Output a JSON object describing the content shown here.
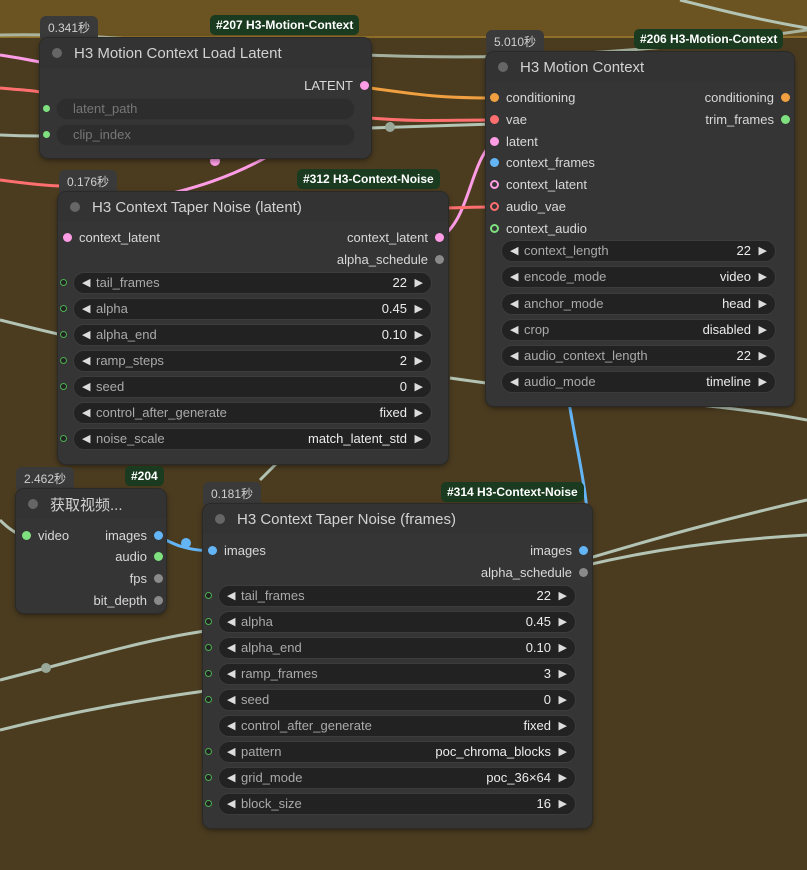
{
  "colors": {
    "canvas": "#4b3c20",
    "node_bg": "#353535",
    "badge_bg": "#1a3b1f",
    "wire_conditioning": "#f0a040",
    "wire_vae": "#ff6f6f",
    "wire_latent": "#ff9ce6",
    "wire_image": "#64b5f6",
    "wire_audio": "#7ee07e",
    "wire_other": "#b4c4b4"
  },
  "nodes": {
    "n207": {
      "timing": "0.341秒",
      "badge": "#207 H3-Motion-Context",
      "title": "H3 Motion Context Load Latent",
      "outputs": [
        "LATENT"
      ],
      "widgets": [
        {
          "name": "latent_path"
        },
        {
          "name": "clip_index"
        }
      ]
    },
    "n206": {
      "timing": "5.010秒",
      "badge": "#206 H3-Motion-Context",
      "title": "H3 Motion Context",
      "inputs": [
        "conditioning",
        "vae",
        "latent",
        "context_frames",
        "context_latent",
        "audio_vae",
        "context_audio"
      ],
      "outputs": [
        "conditioning",
        "trim_frames"
      ],
      "widgets": [
        {
          "name": "context_length",
          "value": "22"
        },
        {
          "name": "encode_mode",
          "value": "video"
        },
        {
          "name": "anchor_mode",
          "value": "head"
        },
        {
          "name": "crop",
          "value": "disabled"
        },
        {
          "name": "audio_context_length",
          "value": "22"
        },
        {
          "name": "audio_mode",
          "value": "timeline"
        }
      ]
    },
    "n312": {
      "timing": "0.176秒",
      "badge": "#312 H3-Context-Noise",
      "title": "H3 Context Taper Noise (latent)",
      "inputs": [
        "context_latent"
      ],
      "outputs": [
        "context_latent",
        "alpha_schedule"
      ],
      "widgets": [
        {
          "name": "tail_frames",
          "value": "22"
        },
        {
          "name": "alpha",
          "value": "0.45"
        },
        {
          "name": "alpha_end",
          "value": "0.10"
        },
        {
          "name": "ramp_steps",
          "value": "2"
        },
        {
          "name": "seed",
          "value": "0"
        },
        {
          "name": "control_after_generate",
          "value": "fixed"
        },
        {
          "name": "noise_scale",
          "value": "match_latent_std"
        }
      ]
    },
    "n204": {
      "timing": "2.462秒",
      "badge": "#204",
      "title": "获取视频...",
      "inputs": [
        "video"
      ],
      "outputs": [
        "images",
        "audio",
        "fps",
        "bit_depth"
      ]
    },
    "n314": {
      "timing": "0.181秒",
      "badge": "#314 H3-Context-Noise",
      "title": "H3 Context Taper Noise (frames)",
      "inputs": [
        "images"
      ],
      "outputs": [
        "images",
        "alpha_schedule"
      ],
      "widgets": [
        {
          "name": "tail_frames",
          "value": "22"
        },
        {
          "name": "alpha",
          "value": "0.45"
        },
        {
          "name": "alpha_end",
          "value": "0.10"
        },
        {
          "name": "ramp_frames",
          "value": "3"
        },
        {
          "name": "seed",
          "value": "0"
        },
        {
          "name": "control_after_generate",
          "value": "fixed"
        },
        {
          "name": "pattern",
          "value": "poc_chroma_blocks"
        },
        {
          "name": "grid_mode",
          "value": "poc_36×64"
        },
        {
          "name": "block_size",
          "value": "16"
        }
      ]
    }
  }
}
